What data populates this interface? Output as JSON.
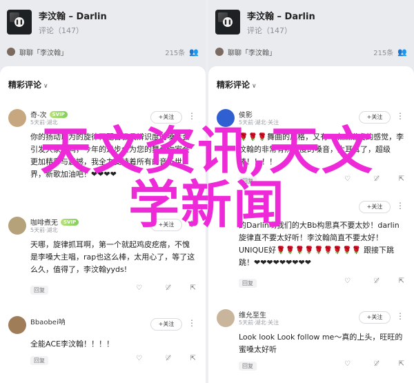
{
  "colors": {
    "accent": "#ee2ad8",
    "svip": "#7fcf5d",
    "heart": "#e02b35"
  },
  "panels": [
    {
      "player": {
        "title": "李汶翰 – Darlin",
        "comments": "评论（147）"
      },
      "chat": {
        "text": "聊聊「李汶翰」",
        "listeners": "215条"
      },
      "header": "精彩评论",
      "comments": [
        {
          "name": "奇-次",
          "badge": "SVIP",
          "time": "5天前·湖北",
          "text": "你的扬动以为的旋律再配合极具辨识度的嗓音会引发大家共鸣，今年的进步会为您的舞台你家会更加精彩与震撼，我全力支持着所有的音乐世界，新歌加油吧！❤❤❤❤",
          "likes": "",
          "avatar": "#c7a77f"
        },
        {
          "name": "咖啡煮无",
          "badge": "SVIP",
          "time": "5天前·湖北",
          "text": "天哪，旋律抓耳啊，第一个就起鸡皮疙瘩，不愧是李嗓大主唱，rap也这么棒，太用心了，等了这么久，值得了，李汶翰yyds!",
          "likes": "",
          "avatar": "#b5a27a"
        },
        {
          "name": "Bbaobei呐",
          "badge": "",
          "time": "",
          "text": "全能ACE李汶翰！！！！",
          "likes": "",
          "avatar": "#a07d59"
        }
      ]
    },
    {
      "player": {
        "title": "李汶翰 – Darlin",
        "comments": "评论（147）"
      },
      "chat": {
        "text": "聊聊「李汶翰」",
        "listeners": "215条"
      },
      "header": "精彩评论",
      "comments": [
        {
          "name": "侯影",
          "badge": "",
          "time": "5天前·湖北·关注",
          "text": "🌹🌹🌹舞曲的风格，又有一点点嫌虔的感觉，李汶翰的非常有辨识度的嗓音，太耳耳了，超级棒！！！！",
          "likes": "",
          "avatar": "#2f5fd0"
        },
        {
          "name": "",
          "badge": "",
          "time": "",
          "text": "的Darlin哟我们的大Bb构思真不要太妙！darlin旋律直不要太好听！李汶翰简直不要太好！UNIQUE好🌹🌹🌹🌹🌹🌹🌹🌹🌹 跟接下跳跳！❤❤❤❤❤❤❤❤❤",
          "likes": "",
          "avatar": "#9aa6b2"
        },
        {
          "name": "维允至生",
          "badge": "",
          "time": "5天前·湖北·关注",
          "text": "Look look Look follow me～真的上头，旺旺的蜜嗓太好听",
          "likes": "",
          "avatar": "#c9b59b"
        }
      ]
    }
  ],
  "labels": {
    "follow": "+关注",
    "reply": "回复"
  },
  "overlay": {
    "line1": "天文资讯,天文",
    "line2": "学新闻"
  }
}
